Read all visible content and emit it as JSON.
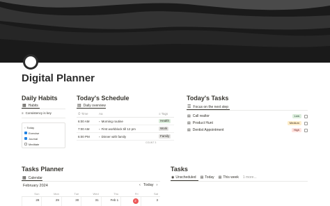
{
  "page": {
    "title": "Digital Planner"
  },
  "habits": {
    "heading": "Daily Habits",
    "view": "Habits",
    "property": "Consistency is key",
    "card": {
      "title": "Today",
      "items": [
        {
          "label": "Exercise",
          "checked": true
        },
        {
          "label": "Journal",
          "checked": true
        },
        {
          "label": "Meditate",
          "checked": false
        }
      ]
    }
  },
  "schedule": {
    "heading": "Today's Schedule",
    "view": "Daily overview",
    "columns": {
      "time": "Time",
      "name": "Aa",
      "tags": "Tags"
    },
    "rows": [
      {
        "time": "6:00 AM",
        "name": "Morning routine",
        "tag": "Health",
        "tag_color": "#dbeddb"
      },
      {
        "time": "7:00 AM",
        "name": "First workblock till 12 pm",
        "tag": "Work",
        "tag_color": "#e3e2e0"
      },
      {
        "time": "6:00 PM",
        "name": "Dinner with family",
        "tag": "Family",
        "tag_color": "#e3e2e0"
      }
    ],
    "count": "COUNT 3"
  },
  "tasks": {
    "heading": "Today's Tasks",
    "view": "Focus on the next step",
    "rows": [
      {
        "name": "Call realtor",
        "priority": "Low",
        "priority_color": "#dbeddb",
        "priority_text": "#1c3829"
      },
      {
        "name": "Product Hunt",
        "priority": "Medium",
        "priority_color": "#fdecc8",
        "priority_text": "#402c1b"
      },
      {
        "name": "Dentist Appointment",
        "priority": "High",
        "priority_color": "#ffe2dd",
        "priority_text": "#5d1715"
      }
    ]
  },
  "tasks_planner": {
    "heading": "Tasks Planner",
    "view": "Calendar",
    "month": "February 2024",
    "today_label": "Today",
    "weekdays": [
      "Sun",
      "Mon",
      "Tue",
      "Wed",
      "Thu",
      "Fri",
      "Sat"
    ],
    "dates": [
      "28",
      "29",
      "30",
      "31",
      "Feb 1",
      "2",
      "3"
    ],
    "today_date": "2"
  },
  "tasks_db": {
    "heading": "Tasks",
    "tabs": [
      "Unscheduled",
      "Today",
      "This week",
      "1 more..."
    ]
  },
  "colors": {
    "cover": "#1a1a1a",
    "today_marker": "#eb5757",
    "checkbox": "#2383e2"
  }
}
